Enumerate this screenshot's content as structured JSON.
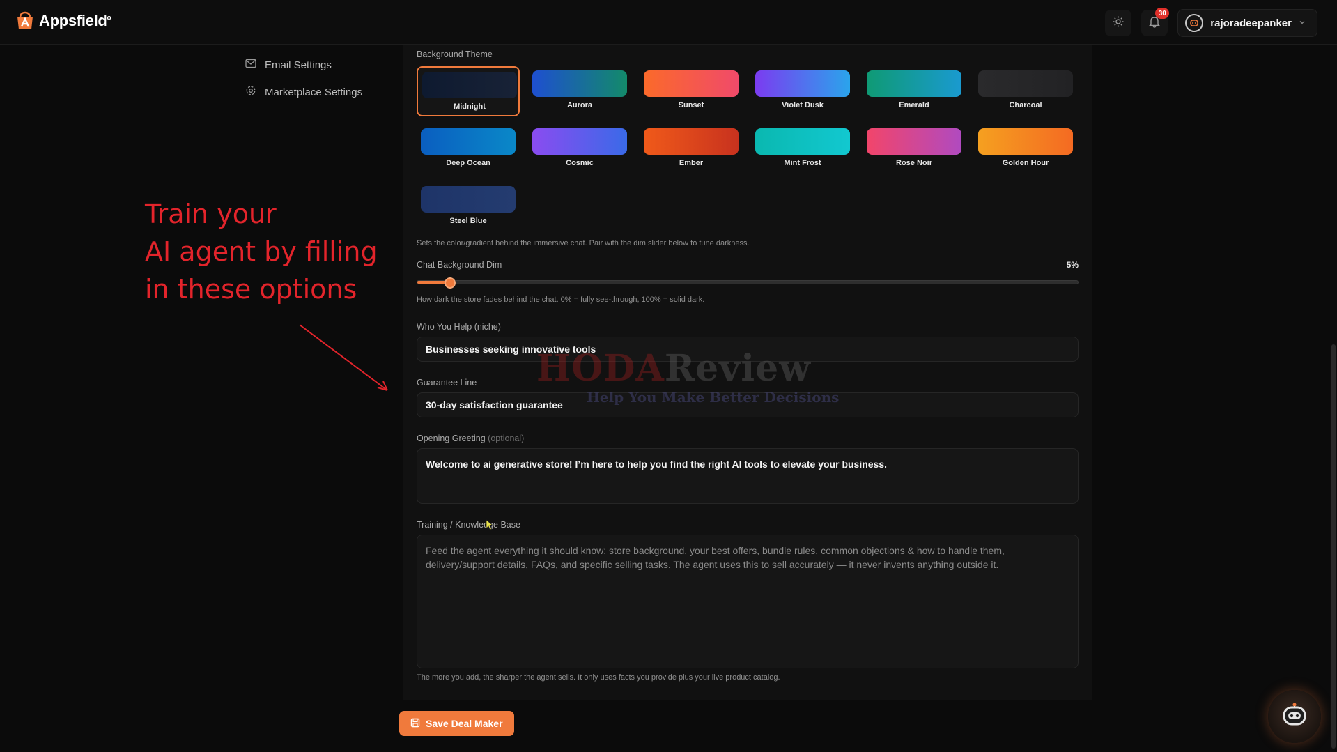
{
  "app": {
    "name": "Appsfield",
    "name_mark": "o"
  },
  "header": {
    "notification_count": "30",
    "username": "rajoradeepanker"
  },
  "sidebar": {
    "items": [
      {
        "label": "Email Settings",
        "icon": "mail-icon"
      },
      {
        "label": "Marketplace Settings",
        "icon": "gear-icon"
      }
    ]
  },
  "annotation": {
    "line1": "Train your",
    "line2": "AI agent by filling",
    "line3": "in these options",
    "color": "#e3242b"
  },
  "background_theme": {
    "label": "Background Theme",
    "selected": "Midnight",
    "themes": [
      {
        "name": "Midnight",
        "from": "#0e1a30",
        "to": "#182236"
      },
      {
        "name": "Aurora",
        "from": "#1e4fd0",
        "to": "#138a6a"
      },
      {
        "name": "Sunset",
        "from": "#fb6a2a",
        "to": "#f04a6a"
      },
      {
        "name": "Violet Dusk",
        "from": "#7b3cf0",
        "to": "#2aa4ec"
      },
      {
        "name": "Emerald",
        "from": "#0f9a74",
        "to": "#1a9ad0"
      },
      {
        "name": "Charcoal",
        "from": "#2a2a2c",
        "to": "#222224"
      },
      {
        "name": "Deep Ocean",
        "from": "#0a5ec0",
        "to": "#0a88c8"
      },
      {
        "name": "Cosmic",
        "from": "#8a4cf0",
        "to": "#3a6ae8"
      },
      {
        "name": "Ember",
        "from": "#f05a1a",
        "to": "#c8321e"
      },
      {
        "name": "Mint Frost",
        "from": "#0ab8b0",
        "to": "#12c8d0"
      },
      {
        "name": "Rose Noir",
        "from": "#f2456a",
        "to": "#b04ac0"
      },
      {
        "name": "Golden Hour",
        "from": "#f5a020",
        "to": "#f46a22"
      },
      {
        "name": "Steel Blue",
        "from": "#1e3468",
        "to": "#243c70"
      }
    ],
    "help": "Sets the color/gradient behind the immersive chat. Pair with the dim slider below to tune darkness."
  },
  "chat_dim": {
    "label": "Chat Background Dim",
    "value": 5,
    "value_text": "5%",
    "help": "How dark the store fades behind the chat. 0% = fully see-through, 100% = solid dark."
  },
  "fields": {
    "niche_label": "Who You Help (niche)",
    "niche_value": "Businesses seeking innovative tools",
    "guarantee_label": "Guarantee Line",
    "guarantee_value": "30-day satisfaction guarantee",
    "greeting_label": "Opening Greeting",
    "greeting_optional": "(optional)",
    "greeting_value": "Welcome to ai generative store! I’m here to help you find the right AI tools to elevate your business.",
    "training_label": "Training / Knowledge Base",
    "training_placeholder": "Feed the agent everything it should know: store background, your best offers, bundle rules, common objections & how to handle them, delivery/support details, FAQs, and specific selling tasks. The agent uses this to sell accurately — it never invents anything outside it.",
    "training_help": "The more you add, the sharper the agent sells. It only uses facts you provide plus your live product catalog."
  },
  "save_button": {
    "label": "Save Deal Maker"
  },
  "watermark": {
    "brand_a": "HODA",
    "brand_b": "Review",
    "tagline": "Help You Make Better Decisions"
  },
  "accent": "#f07a3c"
}
